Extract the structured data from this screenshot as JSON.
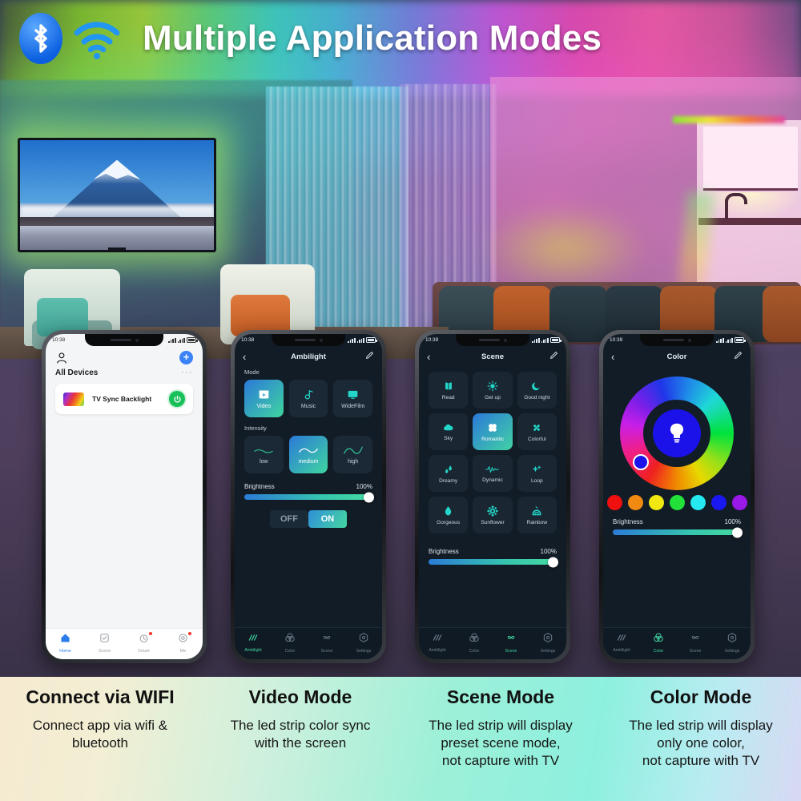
{
  "header": {
    "title": "Multiple Application Modes",
    "bluetooth_icon": "bluetooth-icon",
    "wifi_icon": "wifi-icon",
    "accent_blue": "#0b5fe0",
    "wifi_blue": "#2196f3"
  },
  "phones": [
    {
      "id": "phone-home",
      "theme": "light",
      "status": {
        "time": "10:38",
        "signal": "signal-bars-icon",
        "battery": "battery-icon"
      },
      "header": {
        "avatar": "user-avatar-icon",
        "add": "+"
      },
      "section_title": "All Devices",
      "overflow": "···",
      "device": {
        "name": "TV Sync Backlight",
        "power": "power-icon"
      },
      "nav": [
        {
          "label": "Home",
          "icon": "home-icon",
          "active": true,
          "badge": false
        },
        {
          "label": "Scene",
          "icon": "scene-check-icon",
          "active": false,
          "badge": false
        },
        {
          "label": "Smart",
          "icon": "smart-clock-icon",
          "active": false,
          "badge": true
        },
        {
          "label": "Me",
          "icon": "me-profile-icon",
          "active": false,
          "badge": true
        }
      ]
    },
    {
      "id": "phone-ambilight",
      "theme": "dark",
      "status": {
        "time": "10:38"
      },
      "title": "Ambilight",
      "mode_label": "Mode",
      "modes": [
        {
          "label": "Video",
          "icon": "video-icon",
          "active": true
        },
        {
          "label": "Music",
          "icon": "music-note-icon",
          "active": false
        },
        {
          "label": "WideFilm",
          "icon": "monitor-icon",
          "active": false
        }
      ],
      "intensity_label": "Intensity",
      "intensity": [
        {
          "label": "low",
          "icon": "wave-low-icon",
          "active": false
        },
        {
          "label": "medium",
          "icon": "wave-medium-icon",
          "active": true
        },
        {
          "label": "high",
          "icon": "wave-high-icon",
          "active": false
        }
      ],
      "brightness_label": "Brightness",
      "brightness_value": "100%",
      "toggle": {
        "off": "OFF",
        "on": "ON",
        "state": "ON"
      },
      "nav": [
        {
          "label": "Ambilight",
          "icon": "ambilight-icon",
          "active": true
        },
        {
          "label": "Color",
          "icon": "color-circles-icon",
          "active": false
        },
        {
          "label": "Scene",
          "icon": "scene-pinwheel-icon",
          "active": false
        },
        {
          "label": "Settings",
          "icon": "settings-gear-icon",
          "active": false
        }
      ]
    },
    {
      "id": "phone-scene",
      "theme": "dark",
      "status": {
        "time": "10:39"
      },
      "title": "Scene",
      "scenes": [
        {
          "label": "Read",
          "icon": "book-icon",
          "active": false
        },
        {
          "label": "Get up",
          "icon": "sun-icon",
          "active": false
        },
        {
          "label": "Good night",
          "icon": "moon-icon",
          "active": false
        },
        {
          "label": "Sky",
          "icon": "cloud-icon",
          "active": false
        },
        {
          "label": "Romantic",
          "icon": "clover-icon",
          "active": true
        },
        {
          "label": "Colorful",
          "icon": "pinwheel-icon",
          "active": false
        },
        {
          "label": "Dreamy",
          "icon": "droplets-icon",
          "active": false
        },
        {
          "label": "Dynamic",
          "icon": "pulse-icon",
          "active": false
        },
        {
          "label": "Loop",
          "icon": "sparkle-icon",
          "active": false
        },
        {
          "label": "Gorgeous",
          "icon": "waterdrop-icon",
          "active": false
        },
        {
          "label": "Sunflower",
          "icon": "flower-icon",
          "active": false
        },
        {
          "label": "Rainbow",
          "icon": "rainbow-arch-icon",
          "active": false
        }
      ],
      "brightness_label": "Brightness",
      "brightness_value": "100%",
      "nav": [
        {
          "label": "Ambilight",
          "icon": "ambilight-icon",
          "active": false
        },
        {
          "label": "Color",
          "icon": "color-circles-icon",
          "active": false
        },
        {
          "label": "Scene",
          "icon": "scene-pinwheel-icon",
          "active": true
        },
        {
          "label": "Settings",
          "icon": "settings-gear-icon",
          "active": false
        }
      ]
    },
    {
      "id": "phone-color",
      "theme": "dark",
      "status": {
        "time": "10:39"
      },
      "title": "Color",
      "wheel": {
        "selected_color": "#1a12e8",
        "bulb_icon": "bulb-icon"
      },
      "swatches": [
        "#f01010",
        "#f08a10",
        "#f0e810",
        "#22e23a",
        "#25e8f0",
        "#1a18f0",
        "#9a18e8"
      ],
      "brightness_label": "Brightness",
      "brightness_value": "100%",
      "nav": [
        {
          "label": "Ambilight",
          "icon": "ambilight-icon",
          "active": false
        },
        {
          "label": "Color",
          "icon": "color-circles-icon",
          "active": true
        },
        {
          "label": "Scene",
          "icon": "scene-pinwheel-icon",
          "active": false
        },
        {
          "label": "Settings",
          "icon": "settings-gear-icon",
          "active": false
        }
      ]
    }
  ],
  "captions": [
    {
      "title": "Connect via WIFI",
      "body": "Connect app via wifi &\nbluetooth"
    },
    {
      "title": "Video Mode",
      "body": "The led strip color sync\nwith the screen"
    },
    {
      "title": "Scene Mode",
      "body": "The led strip will display\npreset scene mode,\nnot capture with TV"
    },
    {
      "title": "Color Mode",
      "body": "The led strip will display\nonly one color,\nnot capture with TV"
    }
  ]
}
